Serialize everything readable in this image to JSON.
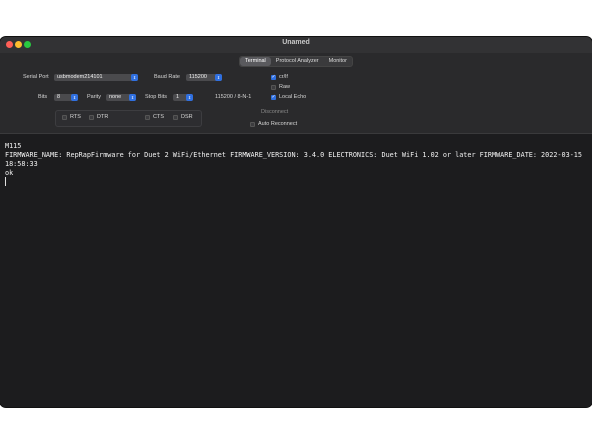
{
  "window": {
    "title": "Unamed"
  },
  "tabs": [
    "Terminal",
    "Protocol Analyzer",
    "Monitor"
  ],
  "settings": {
    "serial_port_label": "Serial Port",
    "serial_port_value": "usbmodem214101",
    "baud_rate_label": "Baud Rate",
    "baud_rate_value": "115200",
    "bits_label": "Bits",
    "bits_value": "8",
    "parity_label": "Parity",
    "parity_value": "none",
    "stop_bits_label": "Stop Bits",
    "stop_bits_value": "1",
    "summary": "115200 / 8-N-1"
  },
  "options": {
    "crlf": {
      "label": "cr/lf",
      "checked": true
    },
    "raw": {
      "label": "Raw",
      "checked": false
    },
    "local_echo": {
      "label": "Local Echo",
      "checked": true
    },
    "auto_reconnect": {
      "label": "Auto Reconnect",
      "checked": false
    }
  },
  "signals": [
    {
      "label": "RTS",
      "checked": false
    },
    {
      "label": "DTR",
      "checked": false
    },
    {
      "label": "CTS",
      "checked": false
    },
    {
      "label": "DSR",
      "checked": false
    }
  ],
  "disconnect_label": "Disconnect",
  "terminal": {
    "lines": [
      "M115",
      "FIRMWARE_NAME: RepRapFirmware for Duet 2 WiFi/Ethernet FIRMWARE_VERSION: 3.4.0 ELECTRONICS: Duet WiFi 1.02 or later FIRMWARE_DATE: 2022-03-15",
      "18:58:33",
      "ok"
    ]
  },
  "colors": {
    "accent": "#2f6fe0",
    "terminal_bg": "#1c1c1e",
    "panel_bg": "#2a2a2c"
  },
  "icons": [
    "close-dot",
    "minimize-dot",
    "zoom-dot",
    "chevron-updown-icon",
    "checkmark-icon"
  ]
}
